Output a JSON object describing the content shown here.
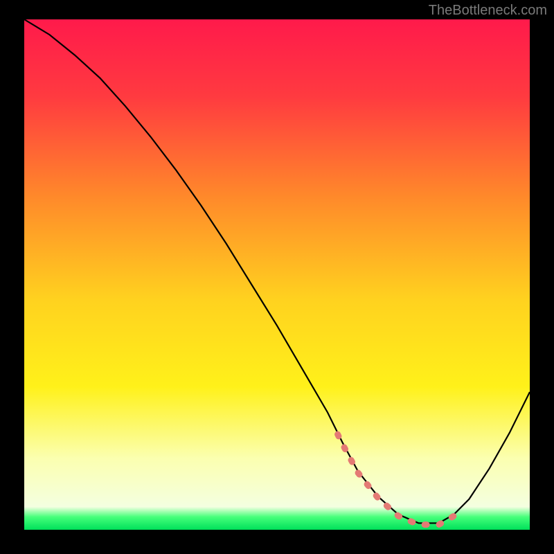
{
  "watermark": "TheBottleneck.com",
  "chart_data": {
    "type": "line",
    "title": "",
    "xlabel": "",
    "ylabel": "",
    "xlim": [
      0,
      100
    ],
    "ylim": [
      0,
      100
    ],
    "series": [
      {
        "name": "curve",
        "x": [
          0,
          5,
          10,
          15,
          20,
          25,
          30,
          35,
          40,
          45,
          50,
          55,
          60,
          63,
          66,
          70,
          74,
          78,
          82,
          85,
          88,
          92,
          96,
          100
        ],
        "values": [
          100,
          97,
          93,
          88.5,
          83,
          77,
          70.5,
          63.5,
          56,
          48,
          40,
          31.5,
          23,
          17,
          11.5,
          6.5,
          3.0,
          1.3,
          1.3,
          3.0,
          6.0,
          12.0,
          19.0,
          27.0
        ]
      }
    ],
    "highlight_region": {
      "name": "low-band",
      "x_range": [
        62,
        85
      ],
      "y_approx": 2.0,
      "description": "dashed salmon marker along curve minimum"
    },
    "background_gradient": {
      "stops": [
        {
          "offset": 0.0,
          "color": "#ff1a4b"
        },
        {
          "offset": 0.15,
          "color": "#ff3a40"
        },
        {
          "offset": 0.35,
          "color": "#ff8a2a"
        },
        {
          "offset": 0.55,
          "color": "#ffd21f"
        },
        {
          "offset": 0.72,
          "color": "#fff11a"
        },
        {
          "offset": 0.86,
          "color": "#fbffb0"
        },
        {
          "offset": 0.955,
          "color": "#f4ffe0"
        },
        {
          "offset": 0.975,
          "color": "#45ff7a"
        },
        {
          "offset": 1.0,
          "color": "#00e05a"
        }
      ]
    }
  }
}
